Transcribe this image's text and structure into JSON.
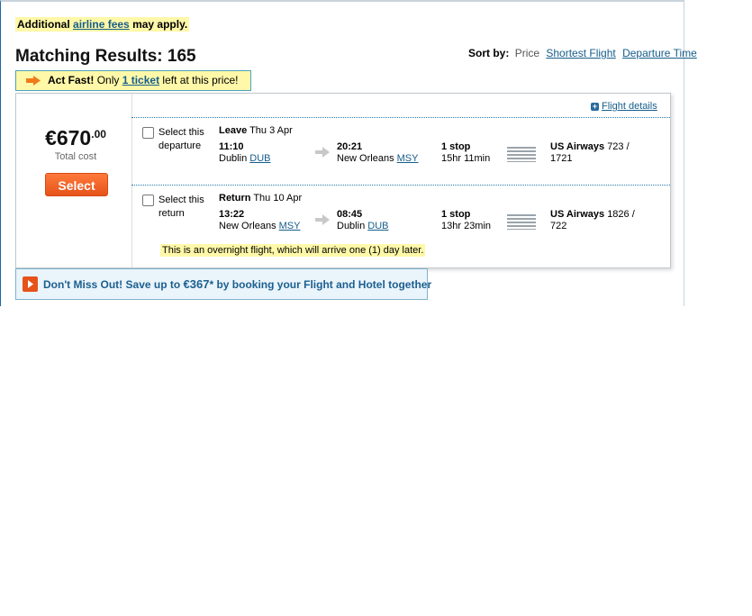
{
  "notice": {
    "prefix": "Additional",
    "link": "airline fees",
    "suffix": "may apply."
  },
  "results": {
    "title": "Matching Results: 165"
  },
  "sort": {
    "label": "Sort by:",
    "options": [
      "Price",
      "Shortest Flight",
      "Departure Time"
    ]
  },
  "act_fast": {
    "bold": "Act Fast!",
    "text1": "Only",
    "link": "1 ticket",
    "text2": "left at this price!"
  },
  "flight_details_link": "Flight details",
  "offer": {
    "price_main": "€670",
    "price_cents": ".00",
    "price_caption": "Total cost",
    "select_label": "Select"
  },
  "legs": [
    {
      "select_label": "Select this departure",
      "direction": "Leave",
      "date": "Thu 3 Apr",
      "depart_time": "11:10",
      "depart_city": "Dublin",
      "depart_code": "DUB",
      "arrive_time": "20:21",
      "arrive_city": "New Orleans",
      "arrive_code": "MSY",
      "stops": "1 stop",
      "duration": "15hr 11min",
      "airline": "US Airways",
      "flight_no": "723 / 1721"
    },
    {
      "select_label": "Select this return",
      "direction": "Return",
      "date": "Thu 10 Apr",
      "depart_time": "13:22",
      "depart_city": "New Orleans",
      "depart_code": "MSY",
      "arrive_time": "08:45",
      "arrive_city": "Dublin",
      "arrive_code": "DUB",
      "stops": "1 stop",
      "duration": "13hr 23min",
      "airline": "US Airways",
      "flight_no": "1826 / 722",
      "note": "This is an overnight flight, which will arrive one (1) day later."
    }
  ],
  "promo": {
    "text1": "Don't Miss Out! Save up to",
    "amount": "€367",
    "text2": "* by booking your Flight and Hotel together"
  },
  "colors": {
    "accent": "#155d8b",
    "highlight": "#fff8a8",
    "button": "#e5531a"
  }
}
